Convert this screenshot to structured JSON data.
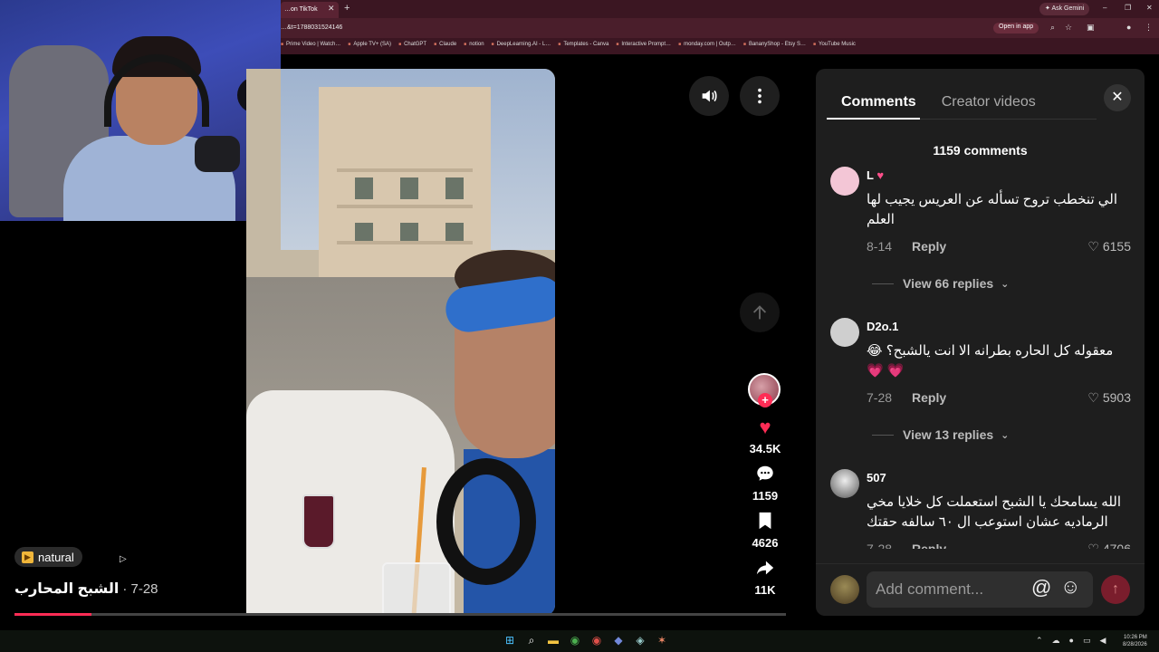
{
  "browser": {
    "tab_title": "…on TikTok",
    "url": "…&t=1788031524146",
    "ask_gemini": "Ask Gemini",
    "open_in_app": "Open in app",
    "bookmarks": [
      "Prime Video | Watch…",
      "Apple TV+ (SA)",
      "ChatGPT",
      "Claude",
      "notion",
      "DeepLearning.AI - L…",
      "Templates - Canva",
      "Interactive Prompt…",
      "monday.com | Outp…",
      "BananyShop - Etsy S…",
      "YouTube Music"
    ]
  },
  "video": {
    "tag": "natural",
    "author": "الشبح المحارب",
    "date": "· 7-28",
    "progress_fraction": 0.1
  },
  "actions": {
    "likes": "34.5K",
    "comments": "1159",
    "saves": "4626",
    "shares": "11K"
  },
  "panel": {
    "tabs": [
      "Comments",
      "Creator videos"
    ],
    "active_tab": 0,
    "comment_count": "1159 comments",
    "input_placeholder": "Add comment...",
    "comments": [
      {
        "user": "L",
        "text": "الي تنخطب تروح تسأله عن العريس يجيب لها العلم",
        "date": "8-14",
        "reply": "Reply",
        "likes": "6155",
        "view_replies": "View 66 replies"
      },
      {
        "user": "D2o.1",
        "text": "معقوله كل الحاره بطرانه الا انت يالشبح؟ 😂 💗 💗",
        "date": "7-28",
        "reply": "Reply",
        "likes": "5903",
        "view_replies": "View 13 replies"
      },
      {
        "user": "507",
        "text": "الله يسامحك يا الشبح استعملت كل خلايا مخي الرماديه عشان استوعب ال ٦٠ سالفه حقتك",
        "date": "7-28",
        "reply": "Reply",
        "likes": "4706"
      }
    ]
  },
  "clock": {
    "time": "10:26 PM",
    "date": "8/28/2026"
  }
}
